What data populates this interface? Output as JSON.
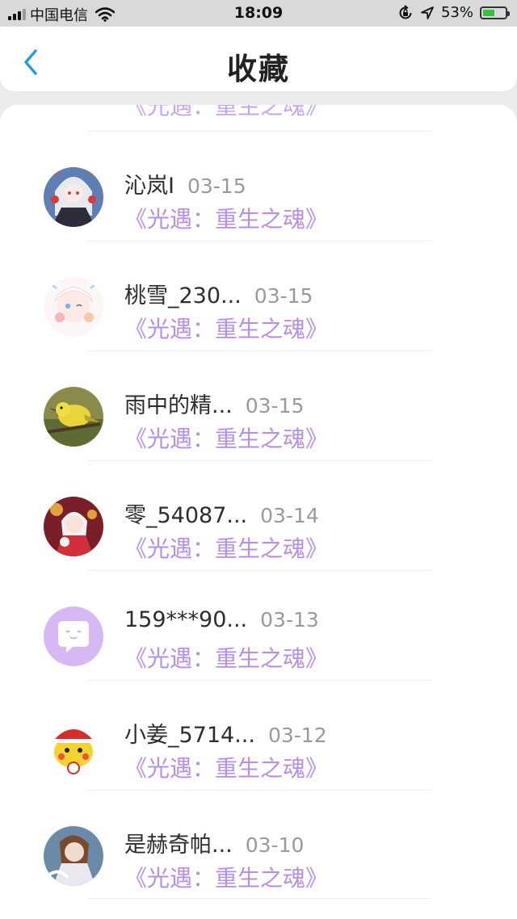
{
  "status_bar": {
    "carrier": "中国电信",
    "time": "18:09",
    "battery": "53%",
    "battery_level": 0.53,
    "icons": [
      "signal-icon",
      "wifi-icon",
      "lock-rotation-icon",
      "location-icon",
      "battery-icon"
    ]
  },
  "header": {
    "title": "收藏",
    "back_icon": "chevron-left-icon"
  },
  "colors": {
    "accent": "#2b97e0",
    "game_title": "#b88ee6",
    "battery": "#35c23f",
    "name": "#2d2d2d",
    "date": "#9a9a9a"
  },
  "list": {
    "partial_item": {
      "game": "《光遇：重生之魂》"
    },
    "items": [
      {
        "name": "沁岚I",
        "date": "03-15",
        "game": "《光遇：重生之魂》"
      },
      {
        "name": "桃雪_230...",
        "date": "03-15",
        "game": "《光遇：重生之魂》"
      },
      {
        "name": "雨中的精...",
        "date": "03-15",
        "game": "《光遇：重生之魂》"
      },
      {
        "name": "零_54087...",
        "date": "03-14",
        "game": "《光遇：重生之魂》"
      },
      {
        "name": "159***90...",
        "date": "03-13",
        "game": "《光遇：重生之魂》"
      },
      {
        "name": "小姜_5714...",
        "date": "03-12",
        "game": "《光遇：重生之魂》"
      },
      {
        "name": "是赫奇帕...",
        "date": "03-10",
        "game": "《光遇：重生之魂》"
      }
    ]
  }
}
